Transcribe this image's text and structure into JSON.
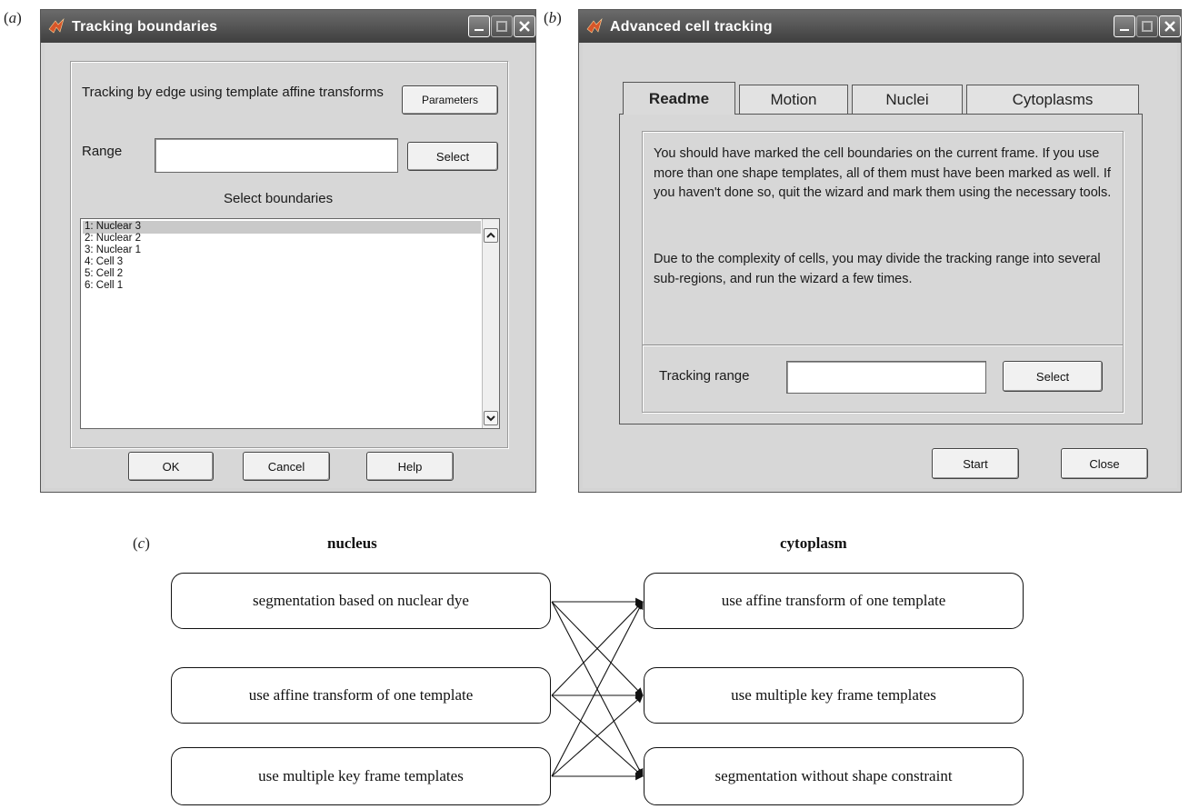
{
  "panel_a": {
    "label": "a",
    "title": "Tracking boundaries",
    "description": "Tracking by edge using template affine transforms",
    "parameters_label": "Parameters",
    "range_label": "Range",
    "range_value": "",
    "select_label": "Select",
    "boundaries_heading": "Select boundaries",
    "boundaries": [
      "1: Nuclear 3",
      "2: Nuclear 2",
      "3: Nuclear 1",
      "4: Cell 3",
      "5: Cell 2",
      "6: Cell 1"
    ],
    "ok_label": "OK",
    "cancel_label": "Cancel",
    "help_label": "Help"
  },
  "panel_b": {
    "label": "b",
    "title": "Advanced cell tracking",
    "tabs": [
      "Readme",
      "Motion",
      "Nuclei",
      "Cytoplasms"
    ],
    "readme_p1": "You should have marked the cell boundaries on the current frame. If you use more than one shape templates, all of them must have been marked as well. If you haven't done so, quit the wizard and mark them using the necessary tools.",
    "readme_p2": "Due to the complexity of cells, you may divide the tracking range into several sub-regions, and run the wizard a few times.",
    "tracking_range_label": "Tracking range",
    "tracking_range_value": "",
    "select_label": "Select",
    "start_label": "Start",
    "close_label": "Close"
  },
  "panel_c": {
    "label": "c",
    "nucleus_heading": "nucleus",
    "cytoplasm_heading": "cytoplasm",
    "nucleus_options": [
      "segmentation based on nuclear dye",
      "use affine transform of one template",
      "use multiple key frame templates"
    ],
    "cytoplasm_options": [
      "use affine transform of one template",
      "use multiple key frame templates",
      "segmentation without shape constraint"
    ]
  }
}
